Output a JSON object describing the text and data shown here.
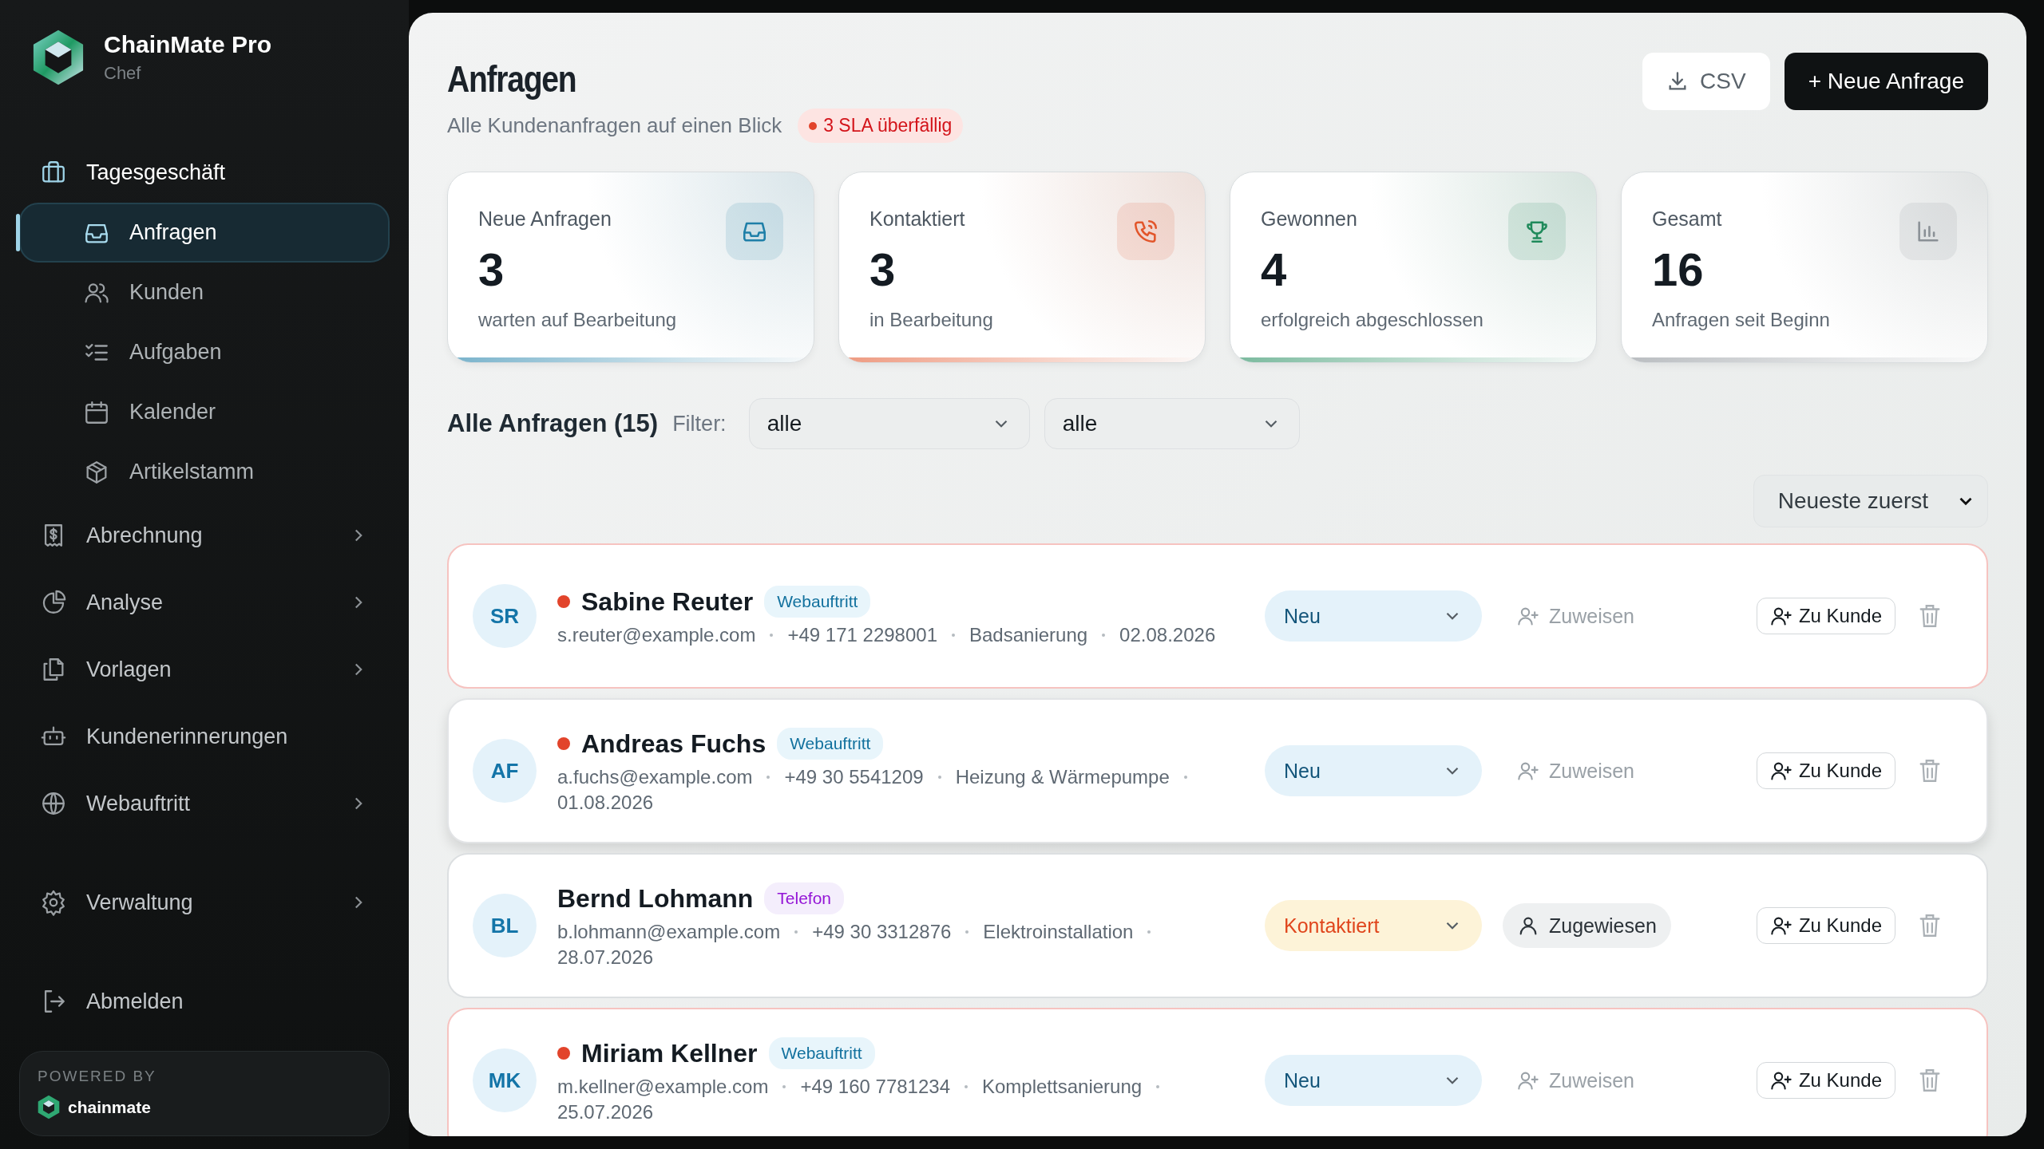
{
  "sidebar": {
    "brand": {
      "name": "ChainMate Pro",
      "role": "Chef"
    },
    "sections": [
      {
        "items": [
          {
            "kind": "heading",
            "label": "Tagesgeschäft",
            "children": [
              {
                "label": "Anfragen",
                "selected": true
              },
              {
                "label": "Kunden",
                "selected": false
              },
              {
                "label": "Aufgaben",
                "selected": false
              },
              {
                "label": "Kalender",
                "selected": false
              },
              {
                "label": "Artikelstamm",
                "selected": false
              }
            ]
          },
          {
            "kind": "group",
            "label": "Abrechnung",
            "expanded": false
          },
          {
            "kind": "group",
            "label": "Analyse",
            "expanded": false
          },
          {
            "kind": "group",
            "label": "Vorlagen",
            "expanded": false
          },
          {
            "kind": "link",
            "label": "Kundenerinnerungen"
          },
          {
            "kind": "group",
            "label": "Webauftritt",
            "expanded": false
          }
        ]
      },
      {
        "items": [
          {
            "kind": "group",
            "label": "Verwaltung",
            "expanded": false
          }
        ]
      },
      {
        "items": [
          {
            "kind": "link",
            "label": "Abmelden"
          }
        ]
      }
    ],
    "footer": {
      "caption": "POWERED BY",
      "brand": "chainmate"
    }
  },
  "header": {
    "title": "Anfragen",
    "subtitle": "Alle Kundenanfragen auf einen Blick",
    "alert": "3 SLA überfällig",
    "buttons": [
      {
        "kind": "secondary",
        "label": "CSV"
      },
      {
        "kind": "primary",
        "label": "+ Neue Anfrage"
      }
    ]
  },
  "stats": [
    {
      "label": "Neue Anfragen",
      "value": "3",
      "caption": "warten auf Bearbeitung",
      "color": "#1e7fa8"
    },
    {
      "label": "Kontaktiert",
      "value": "3",
      "caption": "in Bearbeitung",
      "color": "#e2562b"
    },
    {
      "label": "Gewonnen",
      "value": "4",
      "caption": "erfolgreich abgeschlossen",
      "color": "#1f8a5b"
    },
    {
      "label": "Gesamt",
      "value": "16",
      "caption": "Anfragen seit Beginn",
      "color": "#8a9096"
    }
  ],
  "list": {
    "title": "Alle Anfragen (15)",
    "filter_label": "Filter:",
    "filters": [
      "alle",
      "alle"
    ],
    "sort": "Neueste zuerst",
    "rows": [
      {
        "initials": "SR",
        "name": "Sabine Reuter",
        "overdue": true,
        "hovered": false,
        "source": {
          "kind": "web",
          "label": "Webauftritt"
        },
        "meta": [
          "s.reuter@example.com",
          "+49 171 2298001",
          "Badsanierung",
          "02.08.2026"
        ],
        "status": {
          "kind": "new",
          "label": "Neu"
        },
        "assignee": {
          "assigned": false,
          "label": "Zuweisen"
        },
        "action": "Zu Kunde"
      },
      {
        "initials": "AF",
        "name": "Andreas Fuchs",
        "overdue": true,
        "hovered": true,
        "source": {
          "kind": "web",
          "label": "Webauftritt"
        },
        "meta": [
          "a.fuchs@example.com",
          "+49 30 5541209",
          "Heizung & Wärmepumpe",
          "01.08.2026"
        ],
        "status": {
          "kind": "new",
          "label": "Neu"
        },
        "assignee": {
          "assigned": false,
          "label": "Zuweisen"
        },
        "action": "Zu Kunde"
      },
      {
        "initials": "BL",
        "name": "Bernd Lohmann",
        "overdue": false,
        "hovered": false,
        "source": {
          "kind": "phone",
          "label": "Telefon"
        },
        "meta": [
          "b.lohmann@example.com",
          "+49 30 3312876",
          "Elektroinstallation",
          "28.07.2026"
        ],
        "status": {
          "kind": "contacted",
          "label": "Kontaktiert"
        },
        "assignee": {
          "assigned": true,
          "label": "Zugewiesen"
        },
        "action": "Zu Kunde"
      },
      {
        "initials": "MK",
        "name": "Miriam Kellner",
        "overdue": true,
        "hovered": false,
        "source": {
          "kind": "web",
          "label": "Webauftritt"
        },
        "meta": [
          "m.kellner@example.com",
          "+49 160 7781234",
          "Komplettsanierung",
          "25.07.2026"
        ],
        "status": {
          "kind": "new",
          "label": "Neu"
        },
        "assignee": {
          "assigned": false,
          "label": "Zuweisen"
        },
        "action": "Zu Kunde"
      }
    ]
  }
}
